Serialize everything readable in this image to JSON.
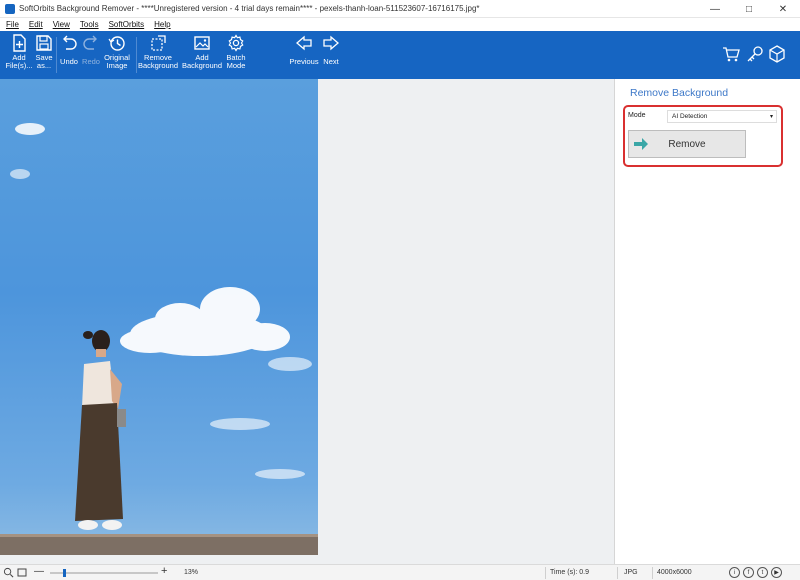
{
  "window": {
    "title": "SoftOrbits Background Remover - ****Unregistered version - 4 trial days remain**** - pexels-thanh-loan-511523607-16716175.jpg*",
    "controls": {
      "minimize": "—",
      "maximize": "□",
      "close": "✕"
    }
  },
  "menu": {
    "file": "File",
    "edit": "Edit",
    "view": "View",
    "tools": "Tools",
    "softorbits": "SoftOrbits",
    "help": "Help"
  },
  "toolbar": {
    "add_files_1": "Add",
    "add_files_2": "File(s)...",
    "save_as_1": "Save",
    "save_as_2": "as...",
    "undo": "Undo",
    "redo": "Redo",
    "original_image_1": "Original",
    "original_image_2": "Image",
    "remove_background_1": "Remove",
    "remove_background_2": "Background",
    "add_background_1": "Add",
    "add_background_2": "Background",
    "batch_mode_1": "Batch",
    "batch_mode_2": "Mode",
    "previous": "Previous",
    "next": "Next",
    "accent": "#1665c2"
  },
  "panel": {
    "title": "Remove Background",
    "mode_label": "Mode",
    "mode_value": "AI Detection",
    "remove_label": "Remove",
    "highlight_color": "#d93030"
  },
  "status": {
    "zoom": "13%",
    "zoom_level": 0.13,
    "time": "Time (s): 0.9",
    "format": "JPG",
    "dimensions": "4000x6000",
    "social": [
      "i",
      "f",
      "t",
      "▶"
    ]
  }
}
